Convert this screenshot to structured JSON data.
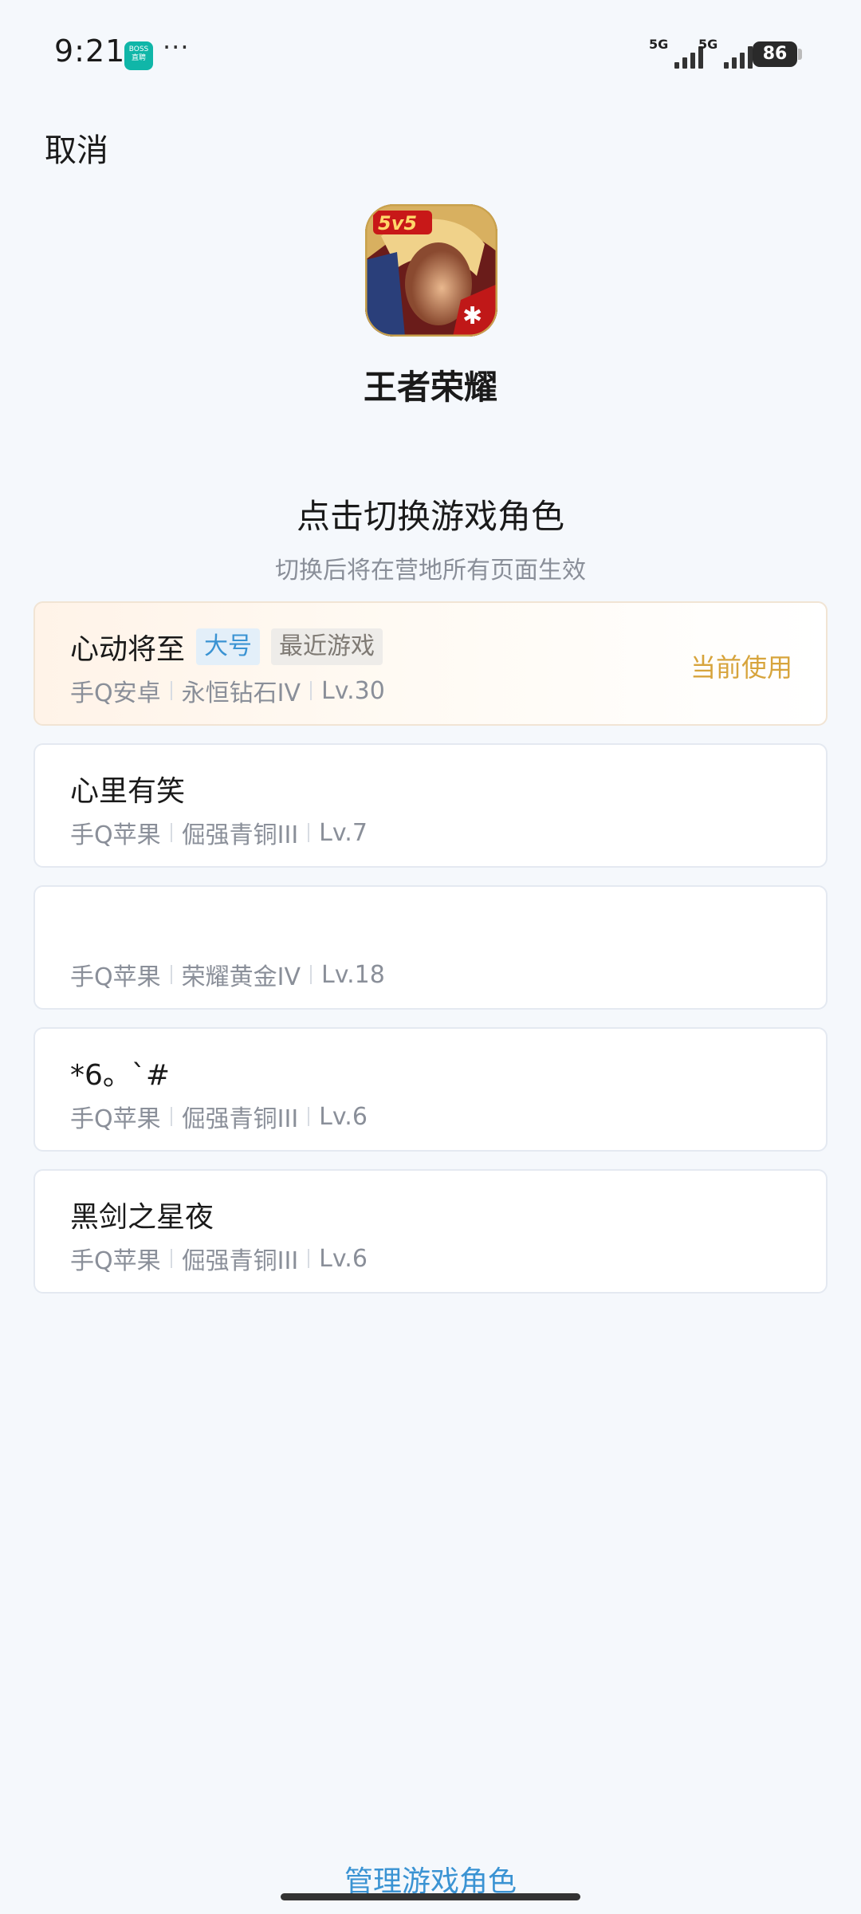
{
  "status_bar": {
    "time": "9:21",
    "boss_badge_line1": "BOSS",
    "boss_badge_line2": "直聘",
    "more_dots": "···",
    "signal1_label": "5G",
    "signal2_label": "5G",
    "battery": "86",
    "boss_badge_color": "#10b6a8",
    "more_icon": "ellipsis-icon",
    "signal_icon": "cellular-signal-icon",
    "battery_icon": "battery-icon"
  },
  "header": {
    "cancel_label": "取消",
    "game_icon": "game-app-icon",
    "game_name": "王者荣耀"
  },
  "section": {
    "title": "点击切换游戏角色",
    "subtitle": "切换后将在营地所有页面生效"
  },
  "roles": [
    {
      "name": "心动将至",
      "tags": [
        "大号",
        "最近游戏"
      ],
      "platform": "手Q安卓",
      "rank": "永恒钻石IV",
      "level": "Lv.30",
      "status": "当前使用"
    },
    {
      "name": "心里有笑",
      "platform": "手Q苹果",
      "rank": "倔强青铜III",
      "level": "Lv.7"
    },
    {
      "name": "",
      "platform": "手Q苹果",
      "rank": "荣耀黄金IV",
      "level": "Lv.18"
    },
    {
      "name": "*6。`#",
      "platform": "手Q苹果",
      "rank": "倔强青铜III",
      "level": "Lv.6"
    },
    {
      "name": "黑剑之星夜",
      "platform": "手Q苹果",
      "rank": "倔强青铜III",
      "level": "Lv.6"
    }
  ],
  "footer": {
    "manage_label": "管理游戏角色"
  },
  "colors": {
    "background": "#f5f8fc",
    "accent_blue": "#3a93d3",
    "current_gold": "#d7a43c",
    "secondary_text": "#8a8f99"
  }
}
